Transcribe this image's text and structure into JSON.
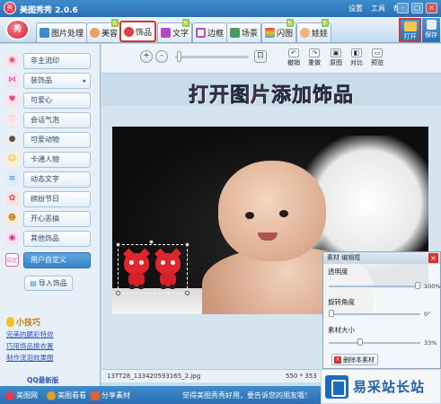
{
  "app": {
    "title": "美图秀秀 2.0.6",
    "logo_text": "秀"
  },
  "menu": [
    "设置",
    "工具",
    "帮助"
  ],
  "window_buttons": [
    "-",
    "□",
    "×"
  ],
  "tabs": [
    {
      "label": "图片处理",
      "badge": ""
    },
    {
      "label": "美容",
      "badge": "新"
    },
    {
      "label": "饰品",
      "badge": ""
    },
    {
      "label": "文字",
      "badge": "新"
    },
    {
      "label": "边框",
      "badge": ""
    },
    {
      "label": "场景",
      "badge": ""
    },
    {
      "label": "闪图",
      "badge": "新"
    },
    {
      "label": "娃娃",
      "badge": "新"
    }
  ],
  "active_tab": "饰品",
  "actions": {
    "open": "打开",
    "save": "保存"
  },
  "sidebar": {
    "items": [
      {
        "label": "非主流印",
        "icon": "lips-icon",
        "color": "#e8457a",
        "arrow": false
      },
      {
        "label": "装饰品",
        "icon": "bow-icon",
        "color": "#c84aa8",
        "arrow": true
      },
      {
        "label": "可爱心",
        "icon": "heart-icon",
        "color": "#e8457a",
        "arrow": false
      },
      {
        "label": "会话气泡",
        "icon": "speech-bubble-icon",
        "color": "#e86a9a",
        "arrow": false
      },
      {
        "label": "可爱动物",
        "icon": "animal-icon",
        "color": "#7a7a7a",
        "arrow": false
      },
      {
        "label": "卡通人物",
        "icon": "cartoon-face-icon",
        "color": "#f0a020",
        "arrow": false
      },
      {
        "label": "动态文字",
        "icon": "text-icon",
        "color": "#3c8ad0",
        "arrow": false
      },
      {
        "label": "缤纷节日",
        "icon": "festival-icon",
        "color": "#e04040",
        "arrow": false
      },
      {
        "label": "开心恶搞",
        "icon": "funny-icon",
        "color": "#d08020",
        "arrow": false
      },
      {
        "label": "其他饰品",
        "icon": "lips-icon",
        "color": "#d0307a",
        "arrow": false
      },
      {
        "label": "用户自定义",
        "icon": "custom-icon",
        "color": "#e060a0",
        "arrow": false
      }
    ],
    "custom_icon_text": "自定",
    "import_label": "导入饰品",
    "tips_title": "小技巧",
    "tips": [
      "完美的腮彩特效",
      "巧用饰品换衣置",
      "制作流泪效果图"
    ],
    "qq_label": "QQ最新版"
  },
  "toolbar": {
    "zoom_in": "+",
    "zoom_out": "-",
    "fit": "⊡",
    "buttons": [
      "撤销",
      "重做",
      "原图",
      "对比",
      "预览"
    ]
  },
  "heading": "打开图片添加饰品",
  "material_panel": {
    "title": "素材 编辑框",
    "close": "×",
    "transparency_label": "透明度",
    "transparency_value": "100%",
    "transparency": 1.0,
    "rotation_label": "旋转角度",
    "rotation_value": "0°",
    "rotation": 0.0,
    "size_label": "素材大小",
    "size_value": "33%",
    "size": 0.33,
    "delete_label": "删除本素材"
  },
  "file_info": {
    "filename": "13TT28_133420593165_2.jpg",
    "dimensions": "550 * 353"
  },
  "statusbar": {
    "items": [
      "美图网",
      "美图看看",
      "分享素材"
    ],
    "message": "觉得美图秀秀好用，要告诉您的朋友哦！"
  },
  "watermark": "易采站长站"
}
